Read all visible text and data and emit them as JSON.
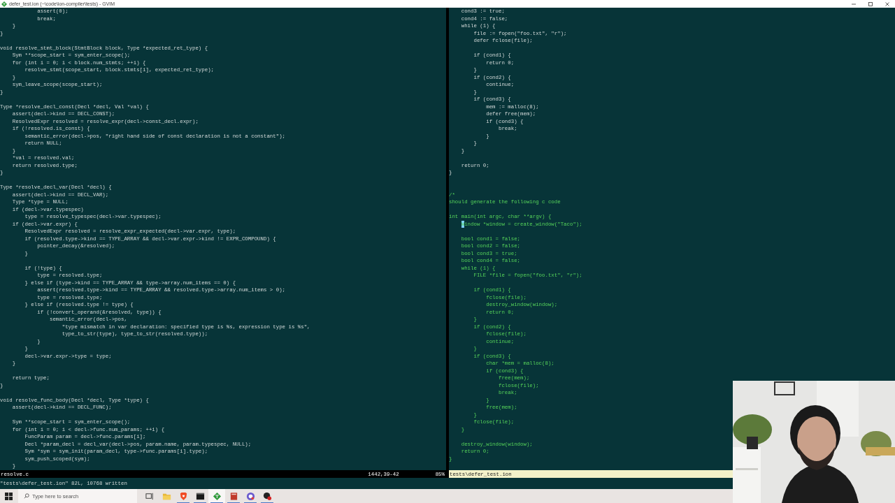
{
  "window": {
    "title": "defer_test.ion (~\\code\\ion-compiler\\tests) - GVIM"
  },
  "panes": [
    {
      "status": {
        "file": "resolve.c",
        "position": "1442,39-42",
        "scroll": "85%",
        "active": false
      },
      "lines": [
        {
          "text": "            assert(0);",
          "kind": "code",
          "cursor": false
        },
        {
          "text": "            break;",
          "kind": "code",
          "cursor": false
        },
        {
          "text": "    }",
          "kind": "code",
          "cursor": false
        },
        {
          "text": "}",
          "kind": "code",
          "cursor": false
        },
        {
          "kind": "blank",
          "cursor": false
        },
        {
          "text": "void resolve_stmt_block(StmtBlock block, Type *expected_ret_type) {",
          "kind": "code",
          "cursor": false
        },
        {
          "text": "    Sym **scope_start = sym_enter_scope();",
          "kind": "code",
          "cursor": false
        },
        {
          "text": "    for (int i = 0; i < block.num_stmts; ++i) {",
          "kind": "code",
          "cursor": false
        },
        {
          "text": "        resolve_stmt(scope_start, block.stmts[i], expected_ret_type);",
          "kind": "code",
          "cursor": false
        },
        {
          "text": "    }",
          "kind": "code",
          "cursor": false
        },
        {
          "text": "    sym_leave_scope(scope_start);",
          "kind": "code",
          "cursor": false
        },
        {
          "text": "}",
          "kind": "code",
          "cursor": false
        },
        {
          "kind": "blank",
          "cursor": false
        },
        {
          "text": "Type *resolve_decl_const(Decl *decl, Val *val) {",
          "kind": "code",
          "cursor": false
        },
        {
          "text": "    assert(decl->kind == DECL_CONST);",
          "kind": "code",
          "cursor": false
        },
        {
          "text": "    ResolvedExpr resolved = resolve_expr(decl->const_decl.expr);",
          "kind": "code",
          "cursor": false
        },
        {
          "text": "    if (!resolved.is_const) {",
          "kind": "code",
          "cursor": false
        },
        {
          "text": "        semantic_error(decl->pos, \"right hand side of const declaration is not a constant\");",
          "kind": "code",
          "cursor": false
        },
        {
          "text": "        return NULL;",
          "kind": "code",
          "cursor": false
        },
        {
          "text": "    }",
          "kind": "code",
          "cursor": false
        },
        {
          "text": "    *val = resolved.val;",
          "kind": "code",
          "cursor": false
        },
        {
          "text": "    return resolved.type;",
          "kind": "code",
          "cursor": false
        },
        {
          "text": "}",
          "kind": "code",
          "cursor": false
        },
        {
          "kind": "blank",
          "cursor": false
        },
        {
          "text": "Type *resolve_decl_var(Decl *decl) {",
          "kind": "code",
          "cursor": false
        },
        {
          "text": "    assert(decl->kind == DECL_VAR);",
          "kind": "code",
          "cursor": false
        },
        {
          "text": "    Type *type = NULL;",
          "kind": "code",
          "cursor": false
        },
        {
          "text": "    if (decl->var.typespec)",
          "kind": "code",
          "cursor": false
        },
        {
          "text": "        type = resolve_typespec(decl->var.typespec);",
          "kind": "code",
          "cursor": false
        },
        {
          "text": "    if (decl->var.expr) {",
          "kind": "code",
          "cursor": false
        },
        {
          "text": "        ResolvedExpr resolved = resolve_expr_expected(decl->var.expr, type);",
          "kind": "code",
          "cursor": false
        },
        {
          "text": "        if (resolved.type->kind == TYPE_ARRAY && decl->var.expr->kind != EXPR_COMPOUND) {",
          "kind": "code",
          "cursor": false
        },
        {
          "text": "            pointer_decay(&resolved);",
          "kind": "code",
          "cursor": false
        },
        {
          "text": "        }",
          "kind": "code",
          "cursor": false
        },
        {
          "kind": "blank",
          "cursor": false
        },
        {
          "text": "        if (!type) {",
          "kind": "code",
          "cursor": false
        },
        {
          "text": "            type = resolved.type;",
          "kind": "code",
          "cursor": false
        },
        {
          "text": "        } else if (type->kind == TYPE_ARRAY && type->array.num_items == 0) {",
          "kind": "code",
          "cursor": false
        },
        {
          "text": "            assert(resolved.type->kind == TYPE_ARRAY && resolved.type->array.num_items > 0);",
          "kind": "code",
          "cursor": false
        },
        {
          "text": "            type = resolved.type;",
          "kind": "code",
          "cursor": false
        },
        {
          "text": "        } else if (resolved.type != type) {",
          "kind": "code",
          "cursor": false
        },
        {
          "text": "            if (!convert_operand(&resolved, type)) {",
          "kind": "code",
          "cursor": false
        },
        {
          "text": "                semantic_error(decl->pos,",
          "kind": "code",
          "cursor": false
        },
        {
          "text": "                    \"type mismatch in var declaration: specified type is %s, expression type is %s\",",
          "kind": "code",
          "cursor": false
        },
        {
          "text": "                    type_to_str(type), type_to_str(resolved.type));",
          "kind": "code",
          "cursor": false
        },
        {
          "text": "            }",
          "kind": "code",
          "cursor": false
        },
        {
          "text": "        }",
          "kind": "code",
          "cursor": false
        },
        {
          "text": "        decl->var.expr->type = type;",
          "kind": "code",
          "cursor": false
        },
        {
          "text": "    }",
          "kind": "code",
          "cursor": false
        },
        {
          "kind": "blank",
          "cursor": false
        },
        {
          "text": "    return type;",
          "kind": "code",
          "cursor": false
        },
        {
          "text": "}",
          "kind": "code",
          "cursor": false
        },
        {
          "kind": "blank",
          "cursor": false
        },
        {
          "text": "void resolve_func_body(Decl *decl, Type *type) {",
          "kind": "code",
          "cursor": false
        },
        {
          "text": "    assert(decl->kind == DECL_FUNC);",
          "kind": "code",
          "cursor": false
        },
        {
          "kind": "blank",
          "cursor": false
        },
        {
          "text": "    Sym **scope_start = sym_enter_scope();",
          "kind": "code",
          "cursor": false
        },
        {
          "text": "    for (int i = 0; i < decl->func.num_params; ++i) {",
          "kind": "code",
          "cursor": false
        },
        {
          "text": "        FuncParam param = decl->func.params[i];",
          "kind": "code",
          "cursor": false
        },
        {
          "text": "        Decl *param_decl = decl_var(decl->pos, param.name, param.typespec, NULL);",
          "kind": "code",
          "cursor": false
        },
        {
          "text": "        Sym *sym = sym_init(param_decl, type->func.params[i].type);",
          "kind": "code",
          "cursor": false
        },
        {
          "text": "        sym_push_scoped(sym);",
          "kind": "code",
          "cursor": false
        },
        {
          "text": "    }",
          "kind": "code",
          "cursor": false
        }
      ]
    },
    {
      "status": {
        "file": "tests\\defer_test.ion",
        "active": true
      },
      "lines": [
        {
          "text": "    cond3 := true;",
          "kind": "code",
          "cursor": false
        },
        {
          "text": "    cond4 := false;",
          "kind": "code",
          "cursor": false
        },
        {
          "text": "    while (1) {",
          "kind": "code",
          "cursor": false
        },
        {
          "text": "        file := fopen(\"foo.txt\", \"r\");",
          "kind": "code",
          "cursor": false
        },
        {
          "text": "        defer fclose(file);",
          "kind": "code",
          "cursor": false
        },
        {
          "kind": "blank",
          "cursor": false
        },
        {
          "text": "        if (cond1) {",
          "kind": "code",
          "cursor": false
        },
        {
          "text": "            return 0;",
          "kind": "code",
          "cursor": false
        },
        {
          "text": "        }",
          "kind": "code",
          "cursor": false
        },
        {
          "text": "        if (cond2) {",
          "kind": "code",
          "cursor": false
        },
        {
          "text": "            continue;",
          "kind": "code",
          "cursor": false
        },
        {
          "text": "        }",
          "kind": "code",
          "cursor": false
        },
        {
          "text": "        if (cond3) {",
          "kind": "code",
          "cursor": false
        },
        {
          "text": "            mem := malloc(8);",
          "kind": "code",
          "cursor": false
        },
        {
          "text": "            defer free(mem);",
          "kind": "code",
          "cursor": false
        },
        {
          "text": "            if (cond3) {",
          "kind": "code",
          "cursor": false
        },
        {
          "text": "                break;",
          "kind": "code",
          "cursor": false
        },
        {
          "text": "            }",
          "kind": "code",
          "cursor": false
        },
        {
          "text": "        }",
          "kind": "code",
          "cursor": false
        },
        {
          "text": "    }",
          "kind": "code",
          "cursor": false
        },
        {
          "kind": "blank",
          "cursor": false
        },
        {
          "text": "    return 0;",
          "kind": "code",
          "cursor": false
        },
        {
          "text": "}",
          "kind": "code",
          "cursor": false
        },
        {
          "kind": "blank",
          "cursor": false
        },
        {
          "kind": "blank",
          "cursor": false
        },
        {
          "text": "/*",
          "kind": "comment",
          "cursor": false
        },
        {
          "text": "should generate the following c code",
          "kind": "comment",
          "cursor": false
        },
        {
          "kind": "blank",
          "cursor": false
        },
        {
          "text": "int main(int argc, char **argv) {",
          "kind": "comment",
          "cursor": false
        },
        {
          "text": "    Window *window = create_window(\"Taco\");",
          "kind": "comment",
          "cursor": true
        },
        {
          "kind": "blank",
          "cursor": false
        },
        {
          "text": "    bool cond1 = false;",
          "kind": "comment",
          "cursor": false
        },
        {
          "text": "    bool cond2 = false;",
          "kind": "comment",
          "cursor": false
        },
        {
          "text": "    bool cond3 = true;",
          "kind": "comment",
          "cursor": false
        },
        {
          "text": "    bool cond4 = false;",
          "kind": "comment",
          "cursor": false
        },
        {
          "text": "    while (1) {",
          "kind": "comment",
          "cursor": false
        },
        {
          "text": "        FILE *file = fopen(\"foo.txt\", \"r\");",
          "kind": "comment",
          "cursor": false
        },
        {
          "kind": "blank",
          "cursor": false
        },
        {
          "text": "        if (cond1) {",
          "kind": "comment",
          "cursor": false
        },
        {
          "text": "            fclose(file);",
          "kind": "comment",
          "cursor": false
        },
        {
          "text": "            destroy_window(window);",
          "kind": "comment",
          "cursor": false
        },
        {
          "text": "            return 0;",
          "kind": "comment",
          "cursor": false
        },
        {
          "text": "        }",
          "kind": "comment",
          "cursor": false
        },
        {
          "text": "        if (cond2) {",
          "kind": "comment",
          "cursor": false
        },
        {
          "text": "            fclose(file);",
          "kind": "comment",
          "cursor": false
        },
        {
          "text": "            continue;",
          "kind": "comment",
          "cursor": false
        },
        {
          "text": "        }",
          "kind": "comment",
          "cursor": false
        },
        {
          "text": "        if (cond3) {",
          "kind": "comment",
          "cursor": false
        },
        {
          "text": "            char *mem = malloc(8);",
          "kind": "comment",
          "cursor": false
        },
        {
          "text": "            if (cond3) {",
          "kind": "comment",
          "cursor": false
        },
        {
          "text": "                free(mem);",
          "kind": "comment",
          "cursor": false
        },
        {
          "text": "                fclose(file);",
          "kind": "comment",
          "cursor": false
        },
        {
          "text": "                break;",
          "kind": "comment",
          "cursor": false
        },
        {
          "text": "            }",
          "kind": "comment",
          "cursor": false
        },
        {
          "text": "            free(mem);",
          "kind": "comment",
          "cursor": false
        },
        {
          "text": "        }",
          "kind": "comment",
          "cursor": false
        },
        {
          "text": "        fclose(file);",
          "kind": "comment",
          "cursor": false
        },
        {
          "text": "    }",
          "kind": "comment",
          "cursor": false
        },
        {
          "kind": "blank",
          "cursor": false
        },
        {
          "text": "    destroy_window(window);",
          "kind": "comment",
          "cursor": false
        },
        {
          "text": "    return 0;",
          "kind": "comment",
          "cursor": false
        },
        {
          "text": "}",
          "kind": "comment",
          "cursor": false
        }
      ]
    }
  ],
  "command_line": "\"tests\\defer_test.ion\" 82L, 10768 written",
  "taskbar": {
    "search": {
      "placeholder": "Type here to search"
    },
    "apps": [
      {
        "kind": "task-view",
        "selected": false,
        "running": false
      },
      {
        "kind": "folder",
        "selected": false,
        "running": false
      },
      {
        "kind": "shield",
        "selected": false,
        "running": true
      },
      {
        "kind": "terminal",
        "selected": false,
        "running": true
      },
      {
        "kind": "editor",
        "selected": true,
        "running": true
      },
      {
        "kind": "book",
        "selected": false,
        "running": true
      },
      {
        "kind": "chat",
        "selected": false,
        "running": true
      },
      {
        "kind": "ball",
        "selected": false,
        "running": true
      }
    ]
  }
}
